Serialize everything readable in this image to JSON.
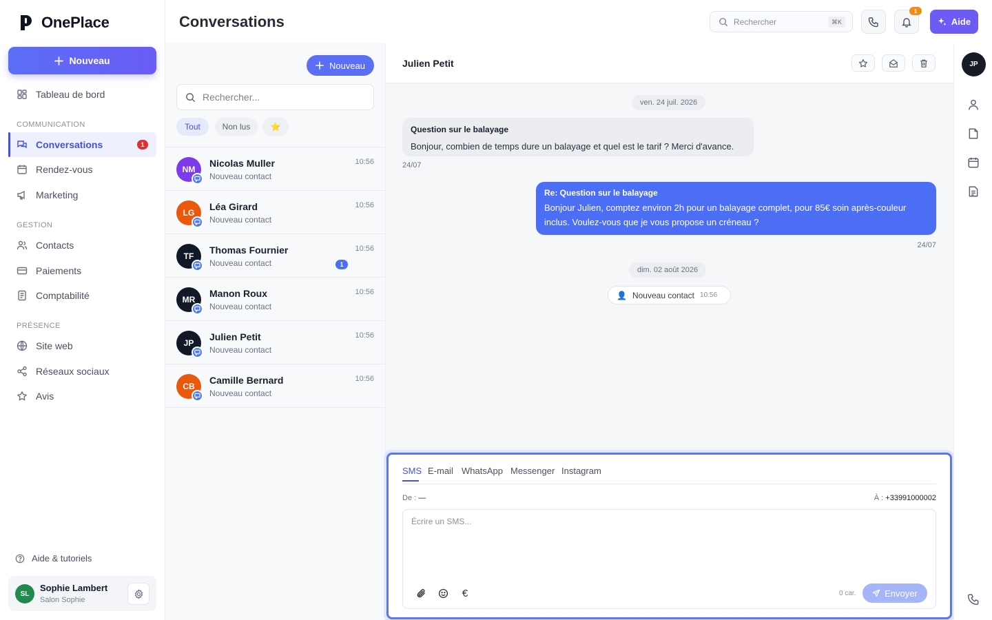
{
  "app": {
    "name": "OnePlace"
  },
  "sidebar": {
    "new_button": "Nouveau",
    "dashboard": "Tableau de bord",
    "sections": [
      {
        "label": "COMMUNICATION",
        "items": [
          {
            "label": "Conversations",
            "icon": "chat-icon",
            "active": true,
            "badge": "1"
          },
          {
            "label": "Rendez-vous",
            "icon": "calendar-icon"
          },
          {
            "label": "Marketing",
            "icon": "megaphone-icon"
          }
        ]
      },
      {
        "label": "GESTION",
        "items": [
          {
            "label": "Contacts",
            "icon": "users-icon"
          },
          {
            "label": "Paiements",
            "icon": "credit-card-icon"
          },
          {
            "label": "Comptabilité",
            "icon": "ledger-icon"
          }
        ]
      },
      {
        "label": "PRÉSENCE",
        "items": [
          {
            "label": "Site web",
            "icon": "globe-icon"
          },
          {
            "label": "Réseaux sociaux",
            "icon": "share-icon"
          },
          {
            "label": "Avis",
            "icon": "star-icon"
          }
        ]
      }
    ],
    "help": "Aide & tutoriels",
    "user": {
      "initials": "SL",
      "name": "Sophie Lambert",
      "business": "Salon Sophie"
    }
  },
  "header": {
    "title": "Conversations",
    "search_placeholder": "Rechercher",
    "shortcut": "⌘K",
    "notifications_count": "1",
    "help_button": "Aide"
  },
  "list": {
    "new_button": "Nouveau",
    "search_placeholder": "Rechercher...",
    "filters": [
      "Tout",
      "Non lus",
      "⭐"
    ],
    "conversations": [
      {
        "initials": "NM",
        "name": "Nicolas Muller",
        "preview": "Nouveau contact",
        "time": "10:56",
        "color": "#7c3aed"
      },
      {
        "initials": "LG",
        "name": "Léa Girard",
        "preview": "Nouveau contact",
        "time": "10:56",
        "color": "#ea580c"
      },
      {
        "initials": "TF",
        "name": "Thomas Fournier",
        "preview": "Nouveau contact",
        "time": "10:56",
        "color": "#111827",
        "unread": "1"
      },
      {
        "initials": "MR",
        "name": "Manon Roux",
        "preview": "Nouveau contact",
        "time": "10:56",
        "color": "#111827"
      },
      {
        "initials": "JP",
        "name": "Julien Petit",
        "preview": "Nouveau contact",
        "time": "10:56",
        "color": "#111827"
      },
      {
        "initials": "CB",
        "name": "Camille Bernard",
        "preview": "Nouveau contact",
        "time": "10:56",
        "color": "#ea580c"
      }
    ]
  },
  "chat": {
    "contact_name": "Julien Petit",
    "contact_initials": "JP",
    "date_1": "ven. 24 juil. 2026",
    "incoming": {
      "subject": "Question sur le balayage",
      "text": "Bonjour, combien de temps dure un balayage et quel est le tarif ? Merci d'avance.",
      "date": "24/07"
    },
    "outgoing": {
      "subject": "Re: Question sur le balayage",
      "text": "Bonjour Julien, comptez environ 2h pour un balayage complet, pour 85€ soin après-couleur inclus. Voulez-vous que je vous propose un créneau ?",
      "date": "24/07"
    },
    "date_2": "dim. 02 août 2026",
    "system_event": {
      "icon": "👤",
      "label": "Nouveau contact",
      "time": "10:56"
    }
  },
  "composer": {
    "tabs": [
      "SMS",
      "E-mail",
      "WhatsApp",
      "Messenger",
      "Instagram"
    ],
    "active_tab": "SMS",
    "from_label": "De :",
    "from_value": "—",
    "to_label": "À :",
    "to_value": "+33991000002",
    "placeholder": "Écrire un SMS...",
    "euro_symbol": "€",
    "char_count": "0 car.",
    "send_button": "Envoyer"
  },
  "colors": {
    "accent": "#4c6ef5",
    "primary_button": "#5b6ef6",
    "help_button": "#6c5cf4",
    "badge_red": "#e0312e",
    "badge_orange": "#f08c18"
  }
}
